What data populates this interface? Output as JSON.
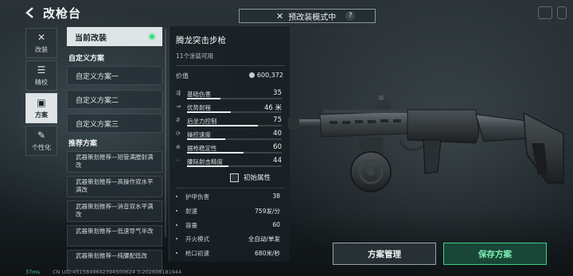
{
  "header": {
    "title": "改枪台",
    "mode_banner": "预改装模式中",
    "help": "?"
  },
  "nav": [
    {
      "label": "改装",
      "icon": "wrench-icon"
    },
    {
      "label": "精校",
      "icon": "sliders-icon"
    },
    {
      "label": "方案",
      "icon": "scheme-icon"
    },
    {
      "label": "个性化",
      "icon": "paint-icon"
    }
  ],
  "schemes": {
    "current_label": "当前改装",
    "custom_heading": "自定义方案",
    "custom": [
      "自定义方案一",
      "自定义方案二",
      "自定义方案三"
    ],
    "recommended_heading": "推荐方案",
    "recommended": [
      "武器策划推荐—短管满膛射满改",
      "武器策划推荐—高操作双水平满改",
      "武器策划推荐—消音双水平满改",
      "武器策划推荐—低速导气半改",
      "武器策划推荐—纯腰配低改"
    ]
  },
  "weapon": {
    "name": "腾龙突击步枪",
    "paints": "11个涂装可用",
    "value_label": "价值",
    "value": "600,372",
    "stats": [
      {
        "label": "基础伤害",
        "value": "35",
        "level": 0.35
      },
      {
        "label": "优势射程",
        "value": "46 米",
        "level": 0.46
      },
      {
        "label": "后坐力控制",
        "value": "75",
        "level": 0.75
      },
      {
        "label": "操控速度",
        "value": "40",
        "level": 0.4
      },
      {
        "label": "据枪稳定性",
        "value": "60",
        "level": 0.6
      },
      {
        "label": "腰际射击精度",
        "value": "44",
        "level": 0.44
      }
    ],
    "initial_attr": "初始属性",
    "props": [
      {
        "label": "护甲伤害",
        "value": "38"
      },
      {
        "label": "射速",
        "value": "759发/分"
      },
      {
        "label": "容量",
        "value": "60"
      },
      {
        "label": "开火模式",
        "value": "全自动/单发"
      },
      {
        "label": "枪口初速",
        "value": "680米/秒"
      }
    ]
  },
  "buttons": {
    "manage": "方案管理",
    "save": "保存方案"
  },
  "status": {
    "ping": "37ms",
    "uid": "CN UID:4515849642394500624 3-202608181944"
  },
  "colors": {
    "accent_green": "#3fcf8a",
    "active_dot": "#34e07a"
  }
}
